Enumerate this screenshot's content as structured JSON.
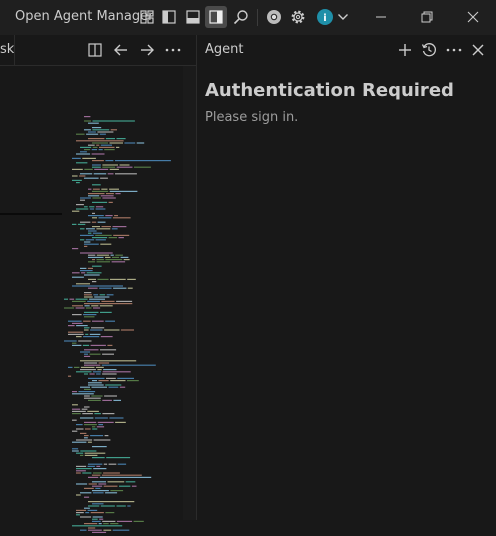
{
  "titlebar": {
    "app_title": "Open Agent Manager",
    "icons": [
      "layout-customize-icon",
      "toggle-primary-sidebar-icon",
      "toggle-panel-icon",
      "toggle-secondary-sidebar-icon",
      "search-icon",
      "chrome-icon",
      "settings-gear-icon",
      "account-avatar-icon",
      "chevron-down-icon"
    ],
    "account_initial": "i",
    "window_controls": [
      "minimize-icon",
      "restore-icon",
      "close-icon"
    ]
  },
  "editor": {
    "tab_fragment": "sk",
    "header_icons": [
      "split-editor-icon",
      "go-back-icon",
      "go-forward-icon",
      "more-actions-icon"
    ]
  },
  "agent_panel": {
    "title": "Agent",
    "header_icons": [
      "new-chat-icon",
      "history-icon",
      "more-icon",
      "close-icon"
    ],
    "heading": "Authentication Required",
    "message": "Please sign in."
  },
  "colors": {
    "background": "#181818",
    "titlebar": "#1f1f1f",
    "text": "#cccccc",
    "muted_text": "#9d9d9d",
    "avatar": "#1f8fa8",
    "active_toggle": "#4a4a4a"
  }
}
